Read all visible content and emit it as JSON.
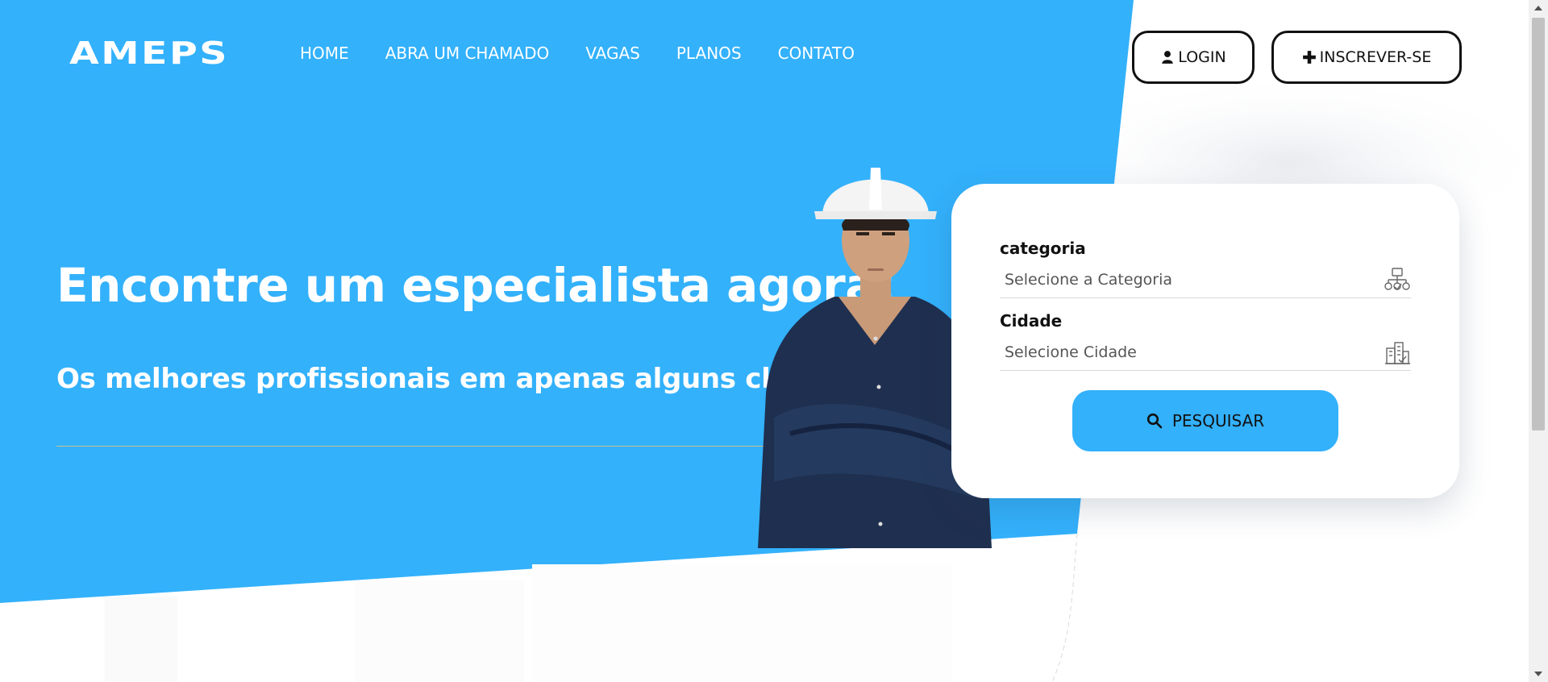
{
  "brand": {
    "logo": "AMEPS"
  },
  "colors": {
    "hero_blue": "#33b1fb",
    "white": "#ffffff",
    "outline": "#111111"
  },
  "nav": {
    "items": [
      {
        "label": "HOME"
      },
      {
        "label": "ABRA UM CHAMADO"
      },
      {
        "label": "VAGAS"
      },
      {
        "label": "PLANOS"
      },
      {
        "label": "CONTATO"
      }
    ]
  },
  "auth": {
    "login_label": "LOGIN",
    "login_icon": "user-icon",
    "signup_label": "INSCREVER-SE",
    "signup_icon": "plus-icon"
  },
  "hero": {
    "title": "Encontre um especialista agora!",
    "subtitle": "Os melhores profissionais em apenas alguns cliques!"
  },
  "search_card": {
    "category": {
      "label": "categoria",
      "placeholder": "Selecione a Categoria",
      "icon": "category-network-icon"
    },
    "city": {
      "label": "Cidade",
      "placeholder": "Selecione Cidade",
      "icon": "city-buildings-icon"
    },
    "search_button": {
      "label": "PESQUISAR",
      "icon": "search-icon"
    }
  }
}
